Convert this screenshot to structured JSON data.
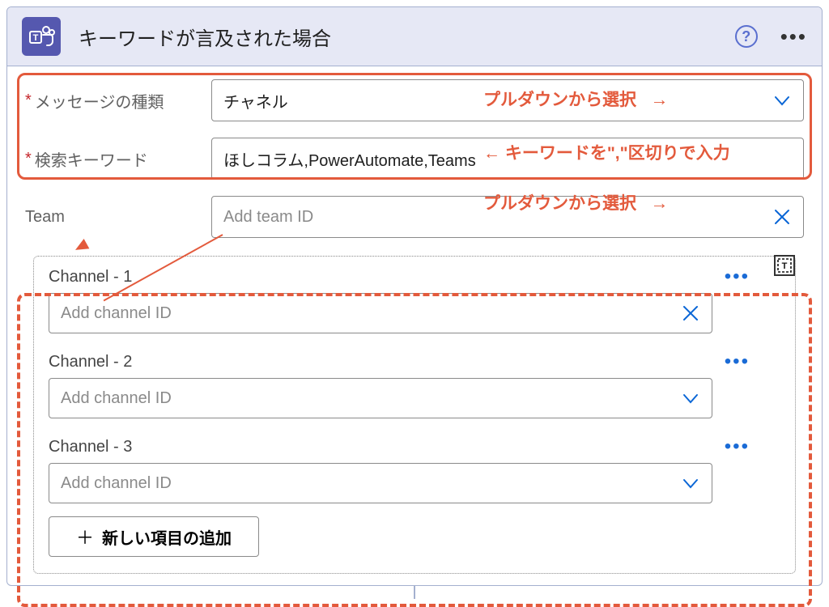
{
  "header": {
    "title": "キーワードが言及された場合"
  },
  "fields": {
    "message_type_label": "メッセージの種類",
    "message_type_value": "チャネル",
    "search_keyword_label": "検索キーワード",
    "search_keyword_value": "ほしコラム,PowerAutomate,Teams",
    "team_label": "Team",
    "team_placeholder": "Add team ID"
  },
  "channels": [
    {
      "label": "Channel - 1",
      "placeholder": "Add channel ID",
      "icon": "x"
    },
    {
      "label": "Channel - 2",
      "placeholder": "Add channel ID",
      "icon": "chev"
    },
    {
      "label": "Channel - 3",
      "placeholder": "Add channel ID",
      "icon": "chev"
    }
  ],
  "add_new_label": "新しい項目の追加",
  "annotations": {
    "pulldown_select": "プルダウンから選択",
    "keyword_hint": "キーワードを\",\"区切りで入力",
    "pulldown_select_2": "プルダウンから選択",
    "left_arrow": "←",
    "right_arrow": "→"
  }
}
